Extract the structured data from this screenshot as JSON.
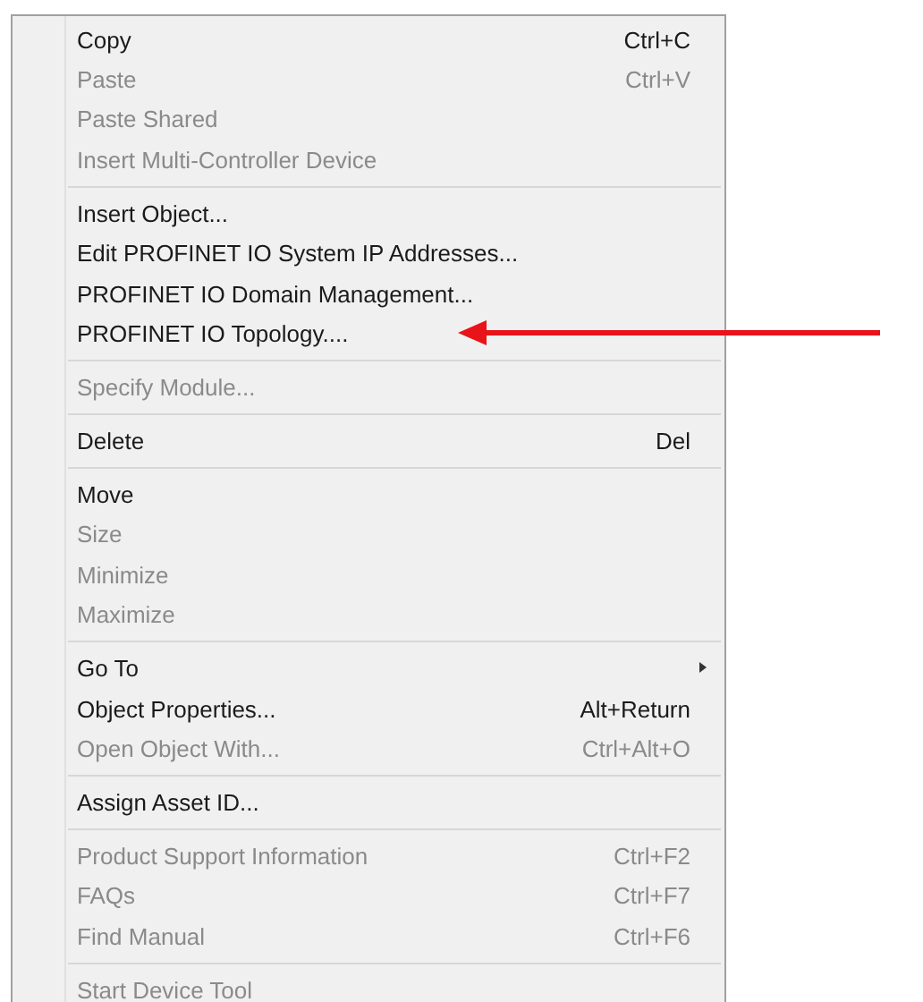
{
  "context_menu": {
    "groups": [
      [
        {
          "label": "Copy",
          "shortcut": "Ctrl+C",
          "disabled": false
        },
        {
          "label": "Paste",
          "shortcut": "Ctrl+V",
          "disabled": true
        },
        {
          "label": "Paste Shared",
          "disabled": true
        },
        {
          "label": "Insert Multi-Controller Device",
          "disabled": true
        }
      ],
      [
        {
          "label": "Insert Object...",
          "disabled": false
        },
        {
          "label": "Edit PROFINET IO System IP Addresses...",
          "disabled": false
        },
        {
          "label": "PROFINET IO Domain Management...",
          "disabled": false
        },
        {
          "label": "PROFINET IO Topology....",
          "disabled": false
        }
      ],
      [
        {
          "label": "Specify Module...",
          "disabled": true
        }
      ],
      [
        {
          "label": "Delete",
          "shortcut": "Del",
          "disabled": false
        }
      ],
      [
        {
          "label": "Move",
          "disabled": false
        },
        {
          "label": "Size",
          "disabled": true
        },
        {
          "label": "Minimize",
          "disabled": true
        },
        {
          "label": "Maximize",
          "disabled": true
        }
      ],
      [
        {
          "label": "Go To",
          "disabled": false,
          "submenu": true
        },
        {
          "label": "Object Properties...",
          "shortcut": "Alt+Return",
          "disabled": false
        },
        {
          "label": "Open Object With...",
          "shortcut": "Ctrl+Alt+O",
          "disabled": true
        }
      ],
      [
        {
          "label": "Assign Asset ID...",
          "disabled": false
        }
      ],
      [
        {
          "label": "Product Support Information",
          "shortcut": "Ctrl+F2",
          "disabled": true
        },
        {
          "label": "FAQs",
          "shortcut": "Ctrl+F7",
          "disabled": true
        },
        {
          "label": "Find Manual",
          "shortcut": "Ctrl+F6",
          "disabled": true
        }
      ],
      [
        {
          "label": "Start Device Tool",
          "disabled": true
        }
      ]
    ]
  }
}
